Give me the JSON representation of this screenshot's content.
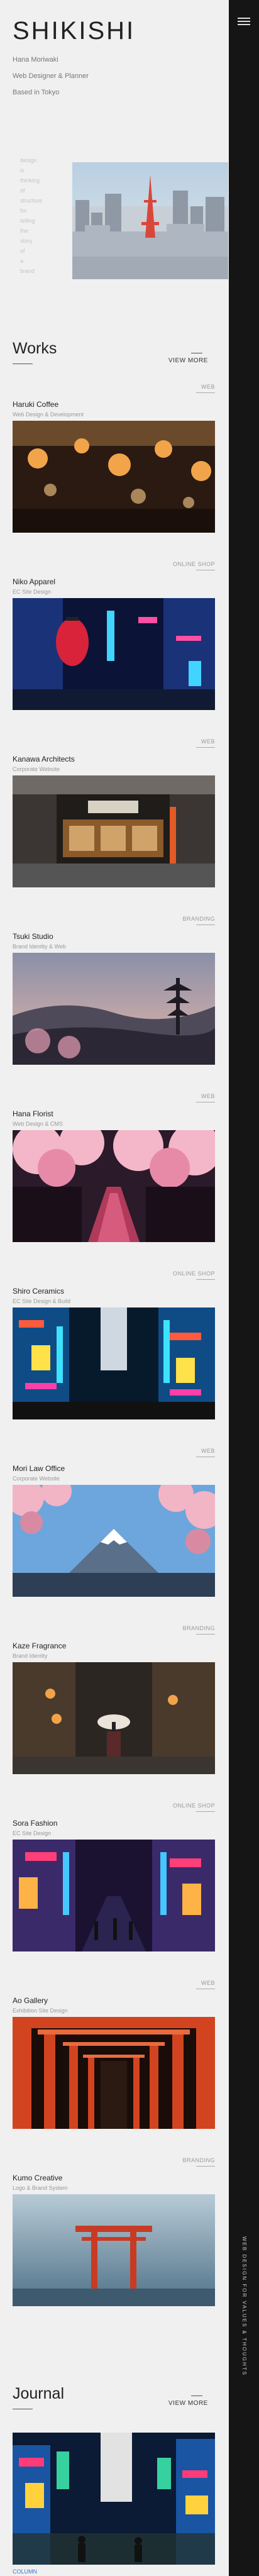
{
  "site": {
    "title": "SHIKISHI",
    "name": "Hana Moriwaki",
    "role": "Web Designer & Planner",
    "location": "Based in Tokyo"
  },
  "hero_vertical_lines": [
    "design",
    "is",
    "thinking",
    "of",
    "structure",
    "for",
    "telling",
    "the",
    "story",
    "of",
    "a",
    "brand"
  ],
  "side_text": "WEB DESIGN FOR VALUES & THOUGHTS",
  "sections": {
    "works": {
      "title": "Works",
      "view_more": "VIEW MORE"
    },
    "journal": {
      "title": "Journal",
      "view_more": "VIEW MORE"
    }
  },
  "works": [
    {
      "tag": "WEB",
      "title": "Haruki Coffee",
      "subtitle": "Web Design & Development",
      "scene": "lanterns"
    },
    {
      "tag": "ONLINE SHOP",
      "title": "Niko Apparel",
      "subtitle": "EC Site Design",
      "scene": "red-lantern"
    },
    {
      "tag": "WEB",
      "title": "Kanawa Architects",
      "subtitle": "Corporate Website",
      "scene": "shopfront"
    },
    {
      "tag": "BRANDING",
      "title": "Tsuki Studio",
      "subtitle": "Brand Identity & Web",
      "scene": "pagoda"
    },
    {
      "tag": "WEB",
      "title": "Hana Florist",
      "subtitle": "Web Design & CMS",
      "scene": "sakura-canal"
    },
    {
      "tag": "ONLINE SHOP",
      "title": "Shiro Ceramics",
      "subtitle": "EC Site Design & Build",
      "scene": "neon-street"
    },
    {
      "tag": "WEB",
      "title": "Mori Law Office",
      "subtitle": "Corporate Website",
      "scene": "fuji"
    },
    {
      "tag": "BRANDING",
      "title": "Kaze Fragrance",
      "subtitle": "Brand Identity",
      "scene": "alley"
    },
    {
      "tag": "ONLINE SHOP",
      "title": "Sora Fashion",
      "subtitle": "EC Site Design",
      "scene": "night-street"
    },
    {
      "tag": "WEB",
      "title": "Ao Gallery",
      "subtitle": "Exhibition Site Design",
      "scene": "torii-tunnel"
    },
    {
      "tag": "BRANDING",
      "title": "Kumo Creative",
      "subtitle": "Logo & Brand System",
      "scene": "sea-torii"
    }
  ],
  "journal_items": [
    {
      "tag": "COLUMN",
      "scene": "city-night"
    }
  ],
  "colors": {
    "background": "#f0f0f0",
    "rail": "#151515",
    "text": "#222222",
    "muted": "#999999"
  },
  "icons": {
    "menu": "hamburger-icon"
  }
}
